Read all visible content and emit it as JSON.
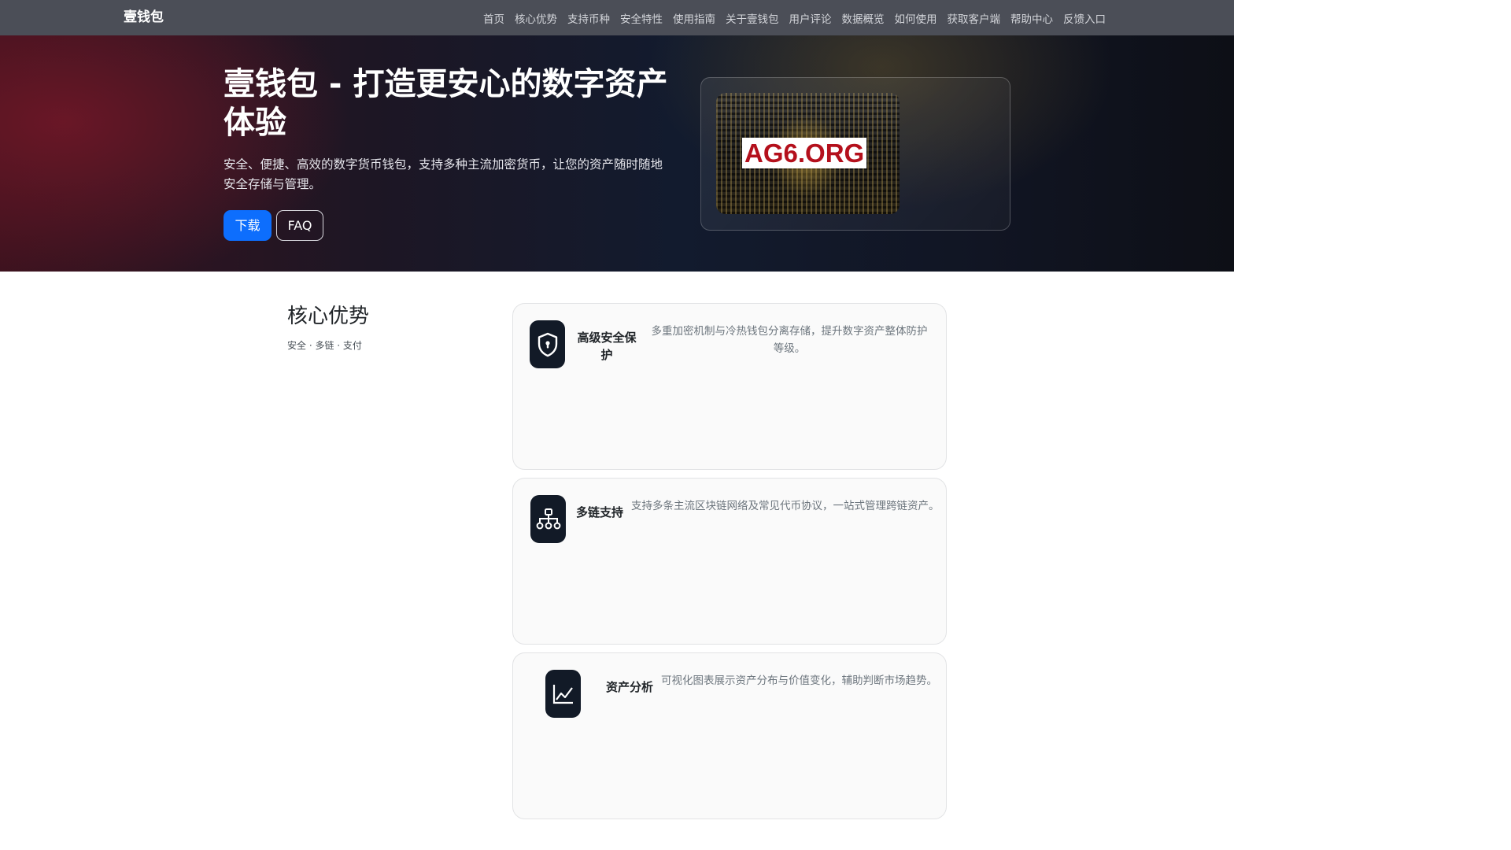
{
  "navbar": {
    "brand": "壹钱包",
    "items": [
      "首页",
      "核心优势",
      "支持币种",
      "安全特性",
      "使用指南",
      "关于壹钱包",
      "用户评论",
      "数据概览",
      "如何使用",
      "获取客户端",
      "帮助中心",
      "反馈入口"
    ]
  },
  "hero": {
    "title": "壹钱包 - 打造更安心的数字资产体验",
    "subtitle": "安全、便捷、高效的数字货币钱包，支持多种主流加密货币，让您的资产随时随地安全存储与管理。",
    "download_label": "下载",
    "faq_label": "FAQ",
    "image_label": "AG6.ORG"
  },
  "section": {
    "title": "核心优势",
    "subtitle": "安全 · 多链 · 支付"
  },
  "features": [
    {
      "icon": "shield-icon",
      "title": "高级安全保护",
      "desc": "多重加密机制与冷热钱包分离存储，提升数字资产整体防护等级。"
    },
    {
      "icon": "network-icon",
      "title": "多链支持",
      "desc": "支持多条主流区块链网络及常见代币协议，一站式管理跨链资产。"
    },
    {
      "icon": "chart-line-icon",
      "title": "资产分析",
      "desc": "可视化图表展示资产分布与价值变化，辅助判断市场趋势。"
    }
  ],
  "colors": {
    "navbar_bg": "#4b4e57",
    "primary_button": "#0d6efd",
    "icon_tile": "#121a27"
  }
}
